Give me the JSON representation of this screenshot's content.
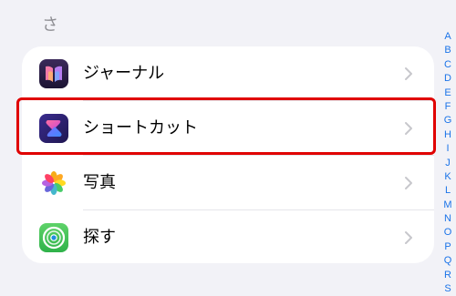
{
  "section": {
    "header": "さ"
  },
  "apps": [
    {
      "label": "ジャーナル",
      "icon": "journal-app-icon"
    },
    {
      "label": "ショートカット",
      "icon": "shortcuts-app-icon"
    },
    {
      "label": "写真",
      "icon": "photos-app-icon"
    },
    {
      "label": "探す",
      "icon": "find-my-app-icon"
    }
  ],
  "index_letters": [
    "A",
    "B",
    "C",
    "D",
    "E",
    "F",
    "G",
    "H",
    "I",
    "J",
    "K",
    "L",
    "M",
    "N",
    "O",
    "P",
    "Q",
    "R",
    "S"
  ],
  "colors": {
    "background": "#f2f2f7",
    "card": "#ffffff",
    "index_accent": "#1a73e8",
    "highlight": "#e00000"
  }
}
